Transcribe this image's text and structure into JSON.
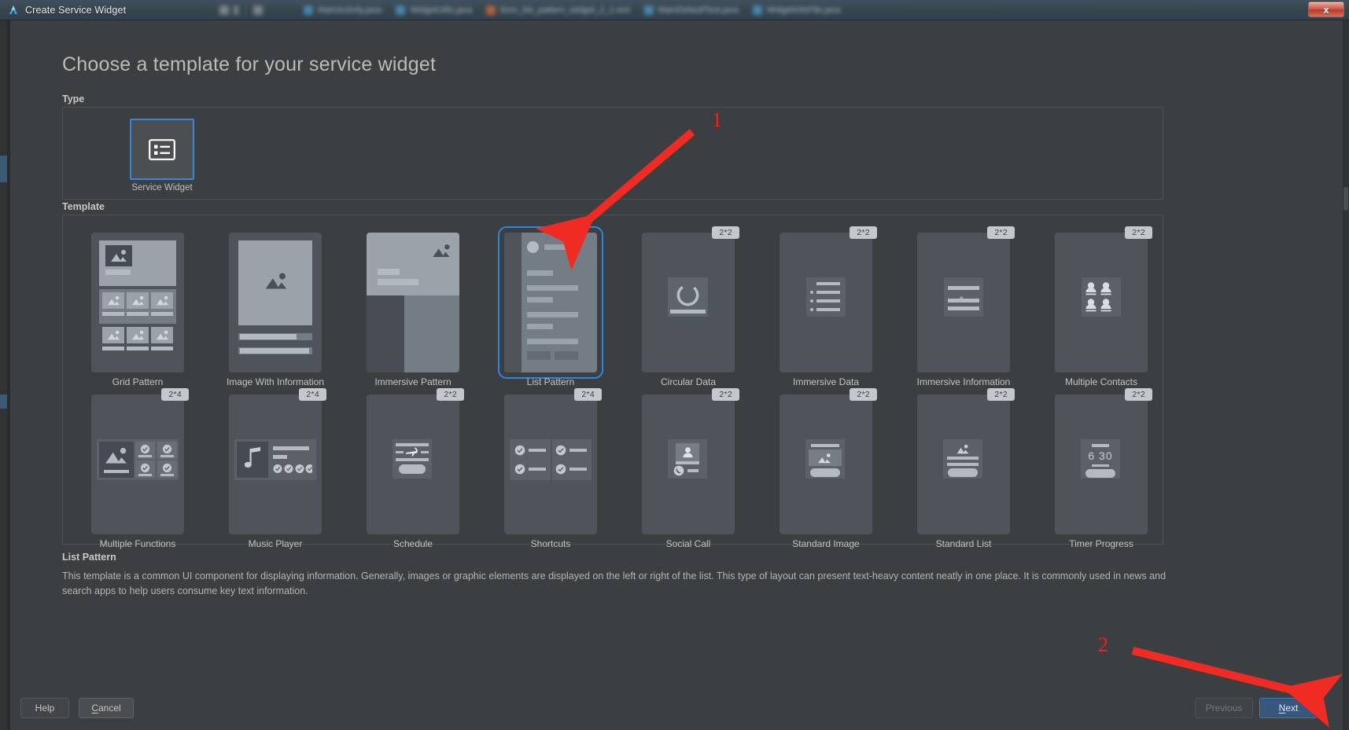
{
  "window": {
    "title": "Create Service Widget",
    "app_icon": "devtools-logo-icon",
    "close_label": "x",
    "tabs": [
      {
        "label": "MainActivity.java",
        "icon": "java-file-icon"
      },
      {
        "label": "WidgetUtils.java",
        "icon": "java-file-icon"
      },
      {
        "label": "form_list_pattern_widget_2_2.xml",
        "icon": "xml-file-icon"
      },
      {
        "label": "MainDefaultTest.java",
        "icon": "java-file-icon"
      },
      {
        "label": "WidgetInfoFile.java",
        "icon": "java-file-icon"
      }
    ]
  },
  "page": {
    "title": "Choose a template for your service widget",
    "type_label": "Type",
    "template_label": "Template"
  },
  "type": {
    "cards": [
      {
        "name": "Service Widget",
        "icon": "list-box-icon",
        "selected": true
      }
    ]
  },
  "templates": [
    {
      "name": "Grid Pattern",
      "badge": "",
      "icon": "grid-pattern-preview",
      "selected": false
    },
    {
      "name": "Image With Information",
      "badge": "",
      "icon": "image-with-information-preview",
      "selected": false
    },
    {
      "name": "Immersive Pattern",
      "badge": "",
      "icon": "immersive-pattern-preview",
      "selected": false
    },
    {
      "name": "List Pattern",
      "badge": "",
      "icon": "list-pattern-preview",
      "selected": true
    },
    {
      "name": "Circular Data",
      "badge": "2*2",
      "icon": "circular-data-preview",
      "selected": false
    },
    {
      "name": "Immersive Data",
      "badge": "2*2",
      "icon": "immersive-data-preview",
      "selected": false
    },
    {
      "name": "Immersive Information",
      "badge": "2*2",
      "icon": "immersive-information-preview",
      "selected": false
    },
    {
      "name": "Multiple Contacts",
      "badge": "2*2",
      "icon": "multiple-contacts-preview",
      "selected": false
    },
    {
      "name": "Multiple Functions",
      "badge": "2*4",
      "icon": "multiple-functions-preview",
      "selected": false
    },
    {
      "name": "Music Player",
      "badge": "2*4",
      "icon": "music-player-preview",
      "selected": false
    },
    {
      "name": "Schedule",
      "badge": "2*2",
      "icon": "schedule-preview",
      "selected": false
    },
    {
      "name": "Shortcuts",
      "badge": "2*4",
      "icon": "shortcuts-preview",
      "selected": false
    },
    {
      "name": "Social Call",
      "badge": "2*2",
      "icon": "social-call-preview",
      "selected": false
    },
    {
      "name": "Standard Image",
      "badge": "2*2",
      "icon": "standard-image-preview",
      "selected": false
    },
    {
      "name": "Standard List",
      "badge": "2*2",
      "icon": "standard-list-preview",
      "selected": false
    },
    {
      "name": "Timer Progress",
      "badge": "2*2",
      "icon": "timer-progress-preview",
      "selected": false
    }
  ],
  "description": {
    "title": "List Pattern",
    "text": "This template is a common UI component for displaying information. Generally, images or graphic elements are displayed on the left or right of the list. This type of layout can present text-heavy content neatly in one place. It is commonly used in news and search apps to help users consume key text information."
  },
  "footer": {
    "help": "Help",
    "cancel": "Cancel",
    "cancel_mnemonic": "C",
    "previous": "Previous",
    "next": "Next",
    "next_mnemonic": "N"
  },
  "annotations": [
    {
      "number": "1",
      "target": "list-pattern-template"
    },
    {
      "number": "2",
      "target": "next-button"
    }
  ],
  "timer_preview": {
    "time": "6 30"
  },
  "colors": {
    "accent_blue": "#3a85d8",
    "annotation_red": "#ee2020",
    "dialog_bg": "#3c3f41",
    "card_bg": "#4f545a",
    "primary_button": "#37577e"
  }
}
